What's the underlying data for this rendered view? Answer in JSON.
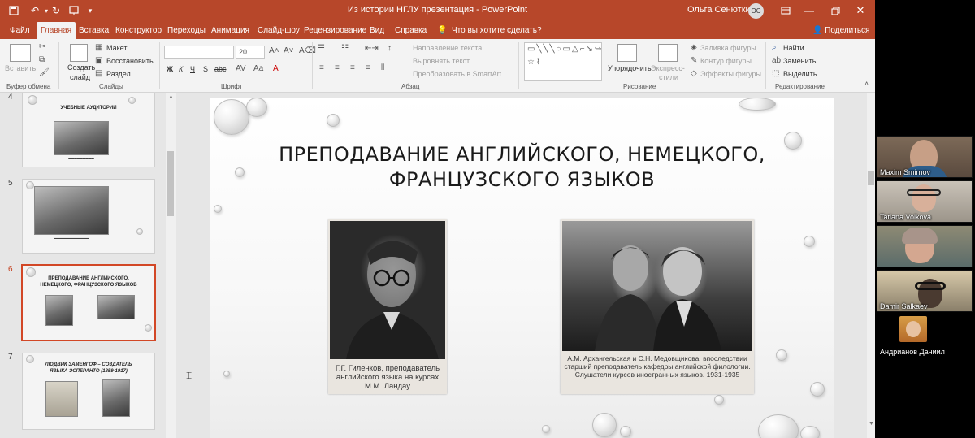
{
  "window": {
    "title": "Из истории НГЛУ презентация  -  PowerPoint",
    "user": "Ольга Сенюткина",
    "user_initials": "ОС"
  },
  "tabs": [
    {
      "label": "Файл",
      "active": false
    },
    {
      "label": "Главная",
      "active": true
    },
    {
      "label": "Вставка",
      "active": false
    },
    {
      "label": "Конструктор",
      "active": false
    },
    {
      "label": "Переходы",
      "active": false
    },
    {
      "label": "Анимация",
      "active": false
    },
    {
      "label": "Слайд-шоу",
      "active": false
    },
    {
      "label": "Рецензирование",
      "active": false
    },
    {
      "label": "Вид",
      "active": false
    },
    {
      "label": "Справка",
      "active": false
    }
  ],
  "tell_me": "Что вы хотите сделать?",
  "share": "Поделиться",
  "ribbon": {
    "clipboard": {
      "paste": "Вставить",
      "label": "Буфер обмена"
    },
    "slides": {
      "create": "Создать",
      "slide": "слайд",
      "layout": "Макет",
      "reset": "Восстановить",
      "section": "Раздел",
      "label": "Слайды"
    },
    "font": {
      "size": "20",
      "label": "Шрифт",
      "bold": "Ж",
      "italic": "К",
      "underline": "Ч",
      "strike": "S",
      "shadow": "abc"
    },
    "paragraph": {
      "text_direction": "Направление текста",
      "align_text": "Выровнять текст",
      "smartart": "Преобразовать в SmartArt",
      "label": "Абзац"
    },
    "drawing": {
      "arrange": "Упорядочить",
      "quick_styles_1": "Экспресс-",
      "quick_styles_2": "стили",
      "fill": "Заливка фигуры",
      "outline": "Контур фигуры",
      "effects": "Эффекты фигуры",
      "label": "Рисование"
    },
    "editing": {
      "find": "Найти",
      "replace": "Заменить",
      "select": "Выделить",
      "label": "Редактирование"
    }
  },
  "thumbnails": [
    {
      "number": "4",
      "title": "УЧЕБНЫЕ АУДИТОРИИ",
      "selected": false
    },
    {
      "number": "5",
      "title": "",
      "selected": false
    },
    {
      "number": "6",
      "title": "ПРЕПОДАВАНИЕ АНГЛИЙСКОГО, НЕМЕЦКОГО, ФРАНЦУЗСКОГО ЯЗЫКОВ",
      "selected": true
    },
    {
      "number": "7",
      "title": "ЛЮДВИК ЗАМЕНГОФ – СОЗДАТЕЛЬ ЯЗЫКА ЭСПЕРАНТО (1859-1917)",
      "selected": false
    }
  ],
  "slide": {
    "title_line1": "ПРЕПОДАВАНИЕ АНГЛИЙСКОГО, НЕМЕЦКОГО,",
    "title_line2": "ФРАНЦУЗСКОГО ЯЗЫКОВ",
    "photo1_caption": "Г.Г. Гиленков, преподаватель английского языка на курсах М.М. Ландау",
    "photo2_caption": "А.М. Архангельская и С.Н. Медовщикова, впоследствии старший преподаватель кафедры английской филологии. Слушатели курсов иностранных языков. 1931-1935"
  },
  "participants": [
    {
      "name": "Maxim Smirnov"
    },
    {
      "name": "Tatiana Volkova"
    },
    {
      "name": ""
    },
    {
      "name": "Damir Salkaev"
    },
    {
      "name": "Андрианов Даниил"
    }
  ]
}
